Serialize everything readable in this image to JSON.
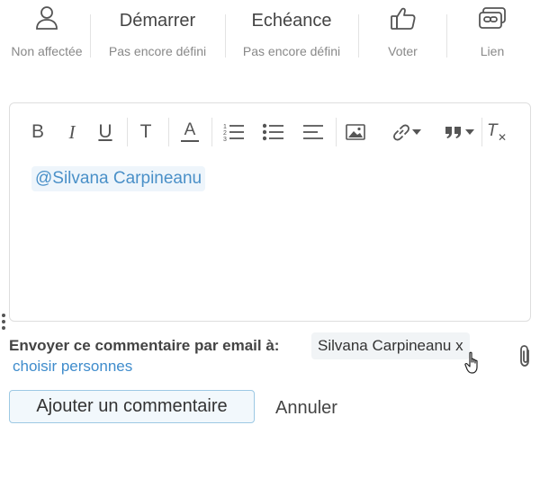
{
  "top_actions": {
    "assignee": {
      "icon": "user-icon",
      "label": "Non affectée"
    },
    "start": {
      "title": "Démarrer",
      "value": "Pas encore défini"
    },
    "due": {
      "title": "Echéance",
      "value": "Pas encore défini"
    },
    "vote": {
      "icon": "thumbs-up-icon",
      "label": "Voter"
    },
    "link": {
      "icon": "link-icon",
      "label": "Lien"
    }
  },
  "editor": {
    "toolbar": {
      "bold": "B",
      "italic": "I",
      "underline": "U",
      "heading": "T",
      "text_color": "A",
      "clear_format": "T"
    },
    "mention": "@Silvana Carpineanu"
  },
  "email": {
    "label": "Envoyer ce commentaire par email à:",
    "recipient": "Silvana Carpineanu x",
    "choose_label": "choisir personnes"
  },
  "actions": {
    "add_label": "Ajouter un commentaire",
    "cancel_label": "Annuler"
  },
  "colors": {
    "accent": "#4a90c8",
    "link": "#3f8ccc",
    "add_border": "#9dc9e4"
  }
}
